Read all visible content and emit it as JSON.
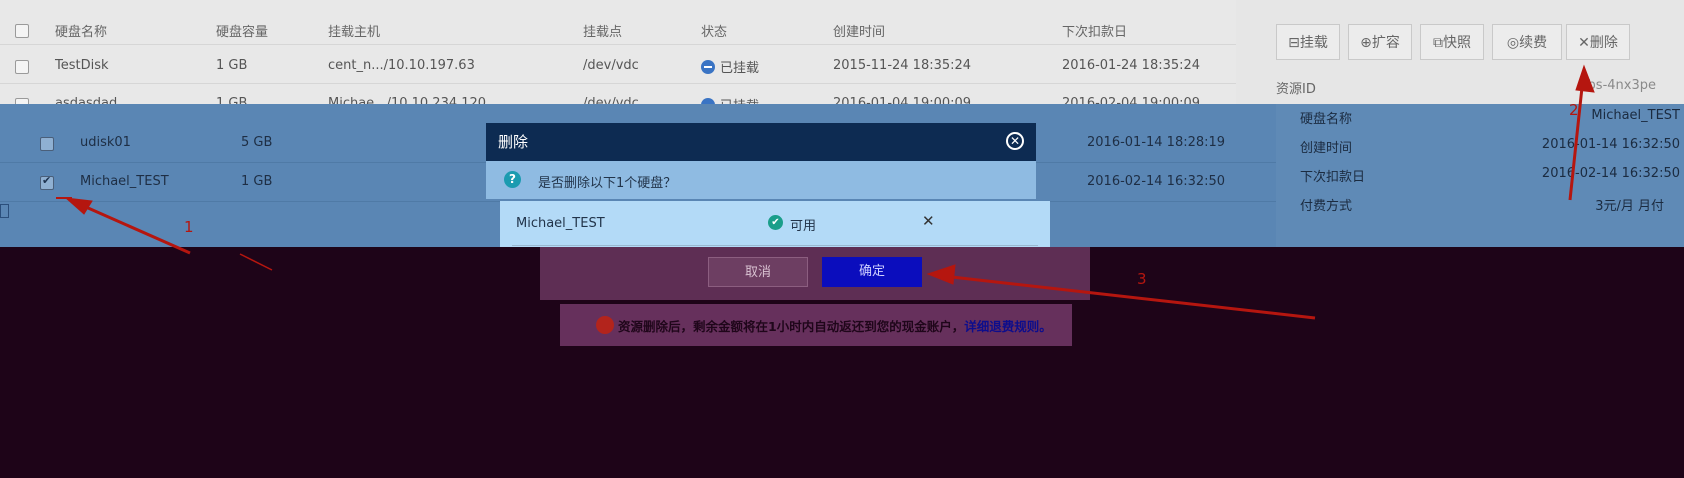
{
  "table": {
    "headers": [
      "硬盘名称",
      "硬盘容量",
      "挂载主机",
      "挂载点",
      "状态",
      "创建时间",
      "下次扣款日"
    ],
    "rows": [
      {
        "name": "TestDisk",
        "size": "1 GB",
        "host": "cent_n.../10.10.197.63",
        "mount": "/dev/vdc",
        "status": "已挂载",
        "created": "2015-11-24 18:35:24",
        "next": "2016-01-24 18:35:24"
      },
      {
        "name": "asdasdad",
        "size": "1 GB",
        "host": "Michae.../10.10.234.120",
        "mount": "/dev/vdc",
        "status": "已挂载",
        "created": "2016-01-04 19:00:09",
        "next": "2016-02-04 19:00:09"
      },
      {
        "name": "udisk01",
        "size": "5 GB",
        "next": "2016-01-14 18:28:19"
      },
      {
        "name": "Michael_TEST",
        "size": "1 GB",
        "next": "2016-02-14 16:32:50"
      }
    ]
  },
  "toolbar": {
    "mount": "挂载",
    "expand": "扩容",
    "snapshot": "快照",
    "renew": "续费",
    "delete": "删除"
  },
  "detail": {
    "resource_id_label": "资源ID",
    "resource_id_value": "bs-4nx3pe",
    "name_label": "硬盘名称",
    "name_value": "Michael_TEST",
    "created_label": "创建时间",
    "created_value": "2016-01-14 16:32:50",
    "next_label": "下次扣款日",
    "next_value": "2016-02-14 16:32:50",
    "pay_label": "付费方式",
    "pay_value": "3元/月 月付"
  },
  "dialog": {
    "title": "删除",
    "question": "是否删除以下1个硬盘？",
    "item_name": "Michael_TEST",
    "item_status": "可用",
    "cancel": "取消",
    "confirm": "确定",
    "notice": "资源删除后，剩余金额将在1小时内自动返还到您的现金账户，",
    "notice_link": "详细退费规则。"
  },
  "annotations": [
    "1",
    "2",
    "3"
  ],
  "colors": {
    "arrow": "#b5160f",
    "confirm_button": "#0b0dbd",
    "header": "#0d2b52"
  }
}
